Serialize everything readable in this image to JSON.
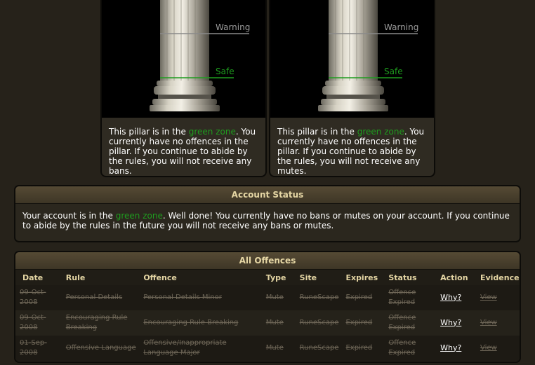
{
  "pillars": [
    {
      "warning_label": "Warning",
      "safe_label": "Safe",
      "text_before": "This pillar is in the ",
      "text_zone": "green zone",
      "text_after": ". You currently have no offences in the pillar. If you continue to abide by the rules, you will not receive any bans."
    },
    {
      "warning_label": "Warning",
      "safe_label": "Safe",
      "text_before": "This pillar is in the ",
      "text_zone": "green zone",
      "text_after": ". You currently have no offences in the pillar. If you continue to abide by the rules, you will not receive any mutes."
    }
  ],
  "account_status": {
    "title": "Account Status",
    "text_before": "Your account is in the ",
    "text_zone": "green zone",
    "text_after": ". Well done! You currently have no bans or mutes on your account. If you continue to abide by the rules in the future you will not receive any bans or mutes."
  },
  "offences": {
    "title": "All Offences",
    "columns": [
      "Date",
      "Rule",
      "Offence",
      "Type",
      "Site",
      "Expires",
      "Status",
      "Action",
      "Evidence"
    ],
    "rows": [
      {
        "date": "09-Oct-2008",
        "rule": "Personal Details",
        "offence": "Personal Details Minor",
        "type": "Mute",
        "site": "RuneScape",
        "expires": "Expired",
        "status": "Offence Expired",
        "action": "Why?",
        "evidence": "View"
      },
      {
        "date": "09-Oct-2008",
        "rule": "Encouraging Rule Breaking",
        "offence": "Encouraging Rule Breaking",
        "type": "Mute",
        "site": "RuneScape",
        "expires": "Expired",
        "status": "Offence Expired",
        "action": "Why?",
        "evidence": "View"
      },
      {
        "date": "01-Sep-2008",
        "rule": "Offensive Language",
        "offence": "Offensive/Inappropriate Language Major",
        "type": "Mute",
        "site": "RuneScape",
        "expires": "Expired",
        "status": "Offence Expired",
        "action": "Why?",
        "evidence": "View"
      }
    ]
  },
  "colors": {
    "green_zone": "#1f9c1f",
    "warning_line": "#8a8a8a",
    "header_text": "#e5d6a4"
  }
}
